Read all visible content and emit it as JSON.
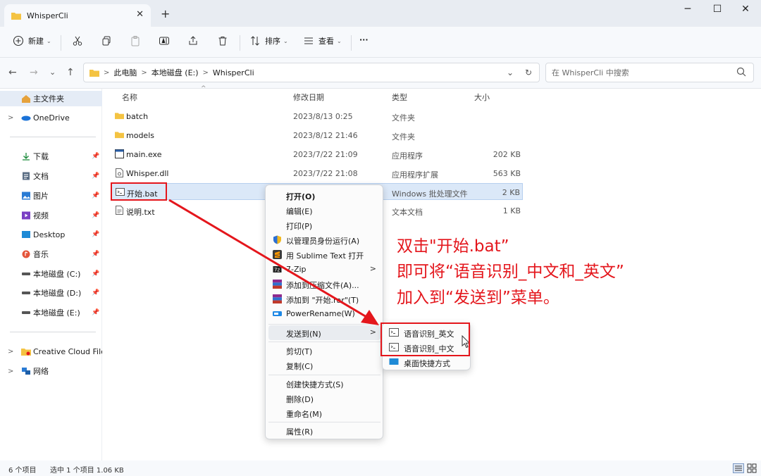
{
  "window": {
    "tab_title": "WhisperCli",
    "close_tab": "✕",
    "new_tab": "+",
    "minimize": "─",
    "maximize": "☐",
    "close": "✕"
  },
  "toolbar": {
    "new_label": "新建",
    "sort_label": "排序",
    "view_label": "查看",
    "more": "···",
    "caret": "⌄"
  },
  "nav": {
    "back": "←",
    "forward": "→",
    "recent": "⌄",
    "up": "↑",
    "breadcrumbs": [
      "此电脑",
      "本地磁盘 (E:)",
      "WhisperCli"
    ],
    "crumb_sep": ">",
    "dropdown": "⌄",
    "refresh": "↻",
    "search_placeholder": "在 WhisperCli 中搜索"
  },
  "sidebar": {
    "items": [
      {
        "label": "主文件夹",
        "chev": ""
      },
      {
        "label": "OneDrive",
        "chev": ">"
      },
      {
        "label": "下载",
        "pin": "📌"
      },
      {
        "label": "文档",
        "pin": "📌"
      },
      {
        "label": "图片",
        "pin": "📌"
      },
      {
        "label": "视频",
        "pin": "📌"
      },
      {
        "label": "Desktop",
        "pin": "📌"
      },
      {
        "label": "音乐",
        "pin": "📌"
      },
      {
        "label": "本地磁盘 (C:)",
        "pin": "📌"
      },
      {
        "label": "本地磁盘 (D:)",
        "pin": "📌"
      },
      {
        "label": "本地磁盘 (E:)",
        "pin": "📌"
      },
      {
        "label": "Creative Cloud Files",
        "chev": ">"
      },
      {
        "label": "网络",
        "chev": ">"
      }
    ]
  },
  "columns": {
    "name": "名称",
    "modified": "修改日期",
    "type": "类型",
    "size": "大小",
    "sort_caret": "^"
  },
  "files": [
    {
      "name": "batch",
      "modified": "2023/8/13 0:25",
      "type": "文件夹",
      "size": ""
    },
    {
      "name": "models",
      "modified": "2023/8/12 21:46",
      "type": "文件夹",
      "size": ""
    },
    {
      "name": "main.exe",
      "modified": "2023/7/22 21:09",
      "type": "应用程序",
      "size": "202 KB"
    },
    {
      "name": "Whisper.dll",
      "modified": "2023/7/22 21:08",
      "type": "应用程序扩展",
      "size": "563 KB"
    },
    {
      "name": "开始.bat",
      "modified": "",
      "type": "Windows 批处理文件",
      "size": "2 KB"
    },
    {
      "name": "说明.txt",
      "modified": "",
      "type": "文本文档",
      "size": "1 KB"
    }
  ],
  "context_menu": {
    "open": "打开(O)",
    "edit": "编辑(E)",
    "print": "打印(P)",
    "run_as_admin": "以管理员身份运行(A)",
    "open_sublime": "用 Sublime Text 打开",
    "zip": "7-Zip",
    "add_archive": "添加到压缩文件(A)...",
    "add_to_rar": "添加到 \"开始.rar\"(T)",
    "power_rename": "PowerRename(W)",
    "send_to": "发送到(N)",
    "cut": "剪切(T)",
    "copy": "复制(C)",
    "create_shortcut": "创建快捷方式(S)",
    "delete": "删除(D)",
    "rename": "重命名(M)",
    "properties": "属性(R)",
    "arrow": ">"
  },
  "send_to_menu": {
    "item_en": "语音识别_英文",
    "item_zh": "语音识别_中文",
    "desktop": "桌面快捷方式"
  },
  "annotation": {
    "line1": "双击\"开始.bat”",
    "line2": "即可将“语音识别_中文和_英文”",
    "line3": "加入到“发送到”菜单。",
    "color": "#e4161c"
  },
  "status": {
    "count": "6 个项目",
    "selected": "选中 1 个项目  1.06 KB"
  }
}
